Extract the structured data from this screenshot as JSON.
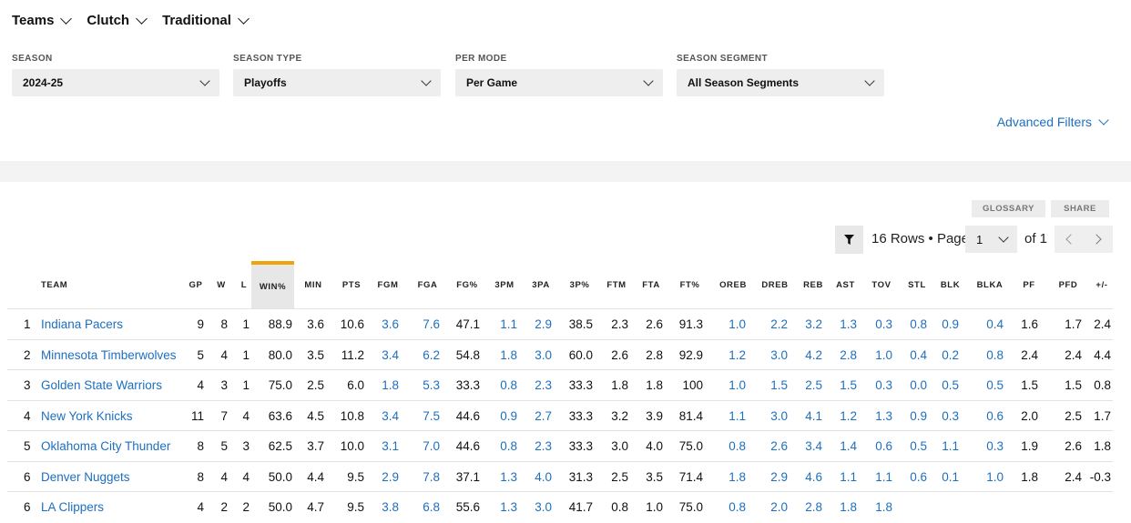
{
  "nav": [
    {
      "label": "Teams"
    },
    {
      "label": "Clutch"
    },
    {
      "label": "Traditional"
    }
  ],
  "filters": [
    {
      "label": "SEASON",
      "value": "2024-25"
    },
    {
      "label": "SEASON TYPE",
      "value": "Playoffs"
    },
    {
      "label": "PER MODE",
      "value": "Per Game"
    },
    {
      "label": "SEASON SEGMENT",
      "value": "All Season Segments"
    }
  ],
  "advanced_filters": "Advanced Filters",
  "buttons": {
    "glossary": "GLOSSARY",
    "share": "SHARE"
  },
  "pagination": {
    "rows_info": "16 Rows • Page",
    "page": "1",
    "of": "of 1"
  },
  "columns": [
    "TEAM",
    "GP",
    "W",
    "L",
    "WIN%",
    "MIN",
    "PTS",
    "FGM",
    "FGA",
    "FG%",
    "3PM",
    "3PA",
    "3P%",
    "FTM",
    "FTA",
    "FT%",
    "OREB",
    "DREB",
    "REB",
    "AST",
    "TOV",
    "STL",
    "BLK",
    "BLKA",
    "PF",
    "PFD",
    "+/-"
  ],
  "rows": [
    {
      "rank": "1",
      "team": "Indiana Pacers",
      "vals": [
        "9",
        "8",
        "1",
        "88.9",
        "3.6",
        "10.6",
        "3.6",
        "7.6",
        "47.1",
        "1.1",
        "2.9",
        "38.5",
        "2.3",
        "2.6",
        "91.3",
        "1.0",
        "2.2",
        "3.2",
        "1.3",
        "0.3",
        "0.8",
        "0.9",
        "0.4",
        "1.6",
        "1.7",
        "2.4"
      ]
    },
    {
      "rank": "2",
      "team": "Minnesota Timberwolves",
      "vals": [
        "5",
        "4",
        "1",
        "80.0",
        "3.5",
        "11.2",
        "3.4",
        "6.2",
        "54.8",
        "1.8",
        "3.0",
        "60.0",
        "2.6",
        "2.8",
        "92.9",
        "1.2",
        "3.0",
        "4.2",
        "2.8",
        "1.0",
        "0.4",
        "0.2",
        "0.8",
        "2.4",
        "2.4",
        "4.4"
      ]
    },
    {
      "rank": "3",
      "team": "Golden State Warriors",
      "vals": [
        "4",
        "3",
        "1",
        "75.0",
        "2.5",
        "6.0",
        "1.8",
        "5.3",
        "33.3",
        "0.8",
        "2.3",
        "33.3",
        "1.8",
        "1.8",
        "100",
        "1.0",
        "1.5",
        "2.5",
        "1.5",
        "0.3",
        "0.0",
        "0.5",
        "0.5",
        "1.5",
        "1.5",
        "0.8"
      ]
    },
    {
      "rank": "4",
      "team": "New York Knicks",
      "vals": [
        "11",
        "7",
        "4",
        "63.6",
        "4.5",
        "10.8",
        "3.4",
        "7.5",
        "44.6",
        "0.9",
        "2.7",
        "33.3",
        "3.2",
        "3.9",
        "81.4",
        "1.1",
        "3.0",
        "4.1",
        "1.2",
        "1.3",
        "0.9",
        "0.3",
        "0.6",
        "2.0",
        "2.5",
        "1.7"
      ]
    },
    {
      "rank": "5",
      "team": "Oklahoma City Thunder",
      "vals": [
        "8",
        "5",
        "3",
        "62.5",
        "3.7",
        "10.0",
        "3.1",
        "7.0",
        "44.6",
        "0.8",
        "2.3",
        "33.3",
        "3.0",
        "4.0",
        "75.0",
        "0.8",
        "2.6",
        "3.4",
        "1.4",
        "0.6",
        "0.5",
        "1.1",
        "0.3",
        "1.9",
        "2.6",
        "1.8"
      ]
    },
    {
      "rank": "6",
      "team": "Denver Nuggets",
      "vals": [
        "8",
        "4",
        "4",
        "50.0",
        "4.4",
        "9.5",
        "2.9",
        "7.8",
        "37.1",
        "1.3",
        "4.0",
        "31.3",
        "2.5",
        "3.5",
        "71.4",
        "1.8",
        "2.9",
        "4.6",
        "1.1",
        "1.1",
        "0.6",
        "0.1",
        "1.0",
        "1.8",
        "2.4",
        "-0.3"
      ]
    },
    {
      "rank": "6",
      "team": "LA Clippers",
      "vals": [
        "4",
        "2",
        "2",
        "50.0",
        "4.7",
        "9.5",
        "3.8",
        "6.8",
        "55.6",
        "1.3",
        "3.0",
        "41.7",
        "0.8",
        "1.0",
        "75.0",
        "0.8",
        "2.0",
        "2.8",
        "1.8",
        "1.8",
        "",
        "",
        "",
        "",
        "",
        ""
      ]
    }
  ],
  "colors": {
    "link": "#1d6fc0",
    "accent": "#f0a30a"
  }
}
